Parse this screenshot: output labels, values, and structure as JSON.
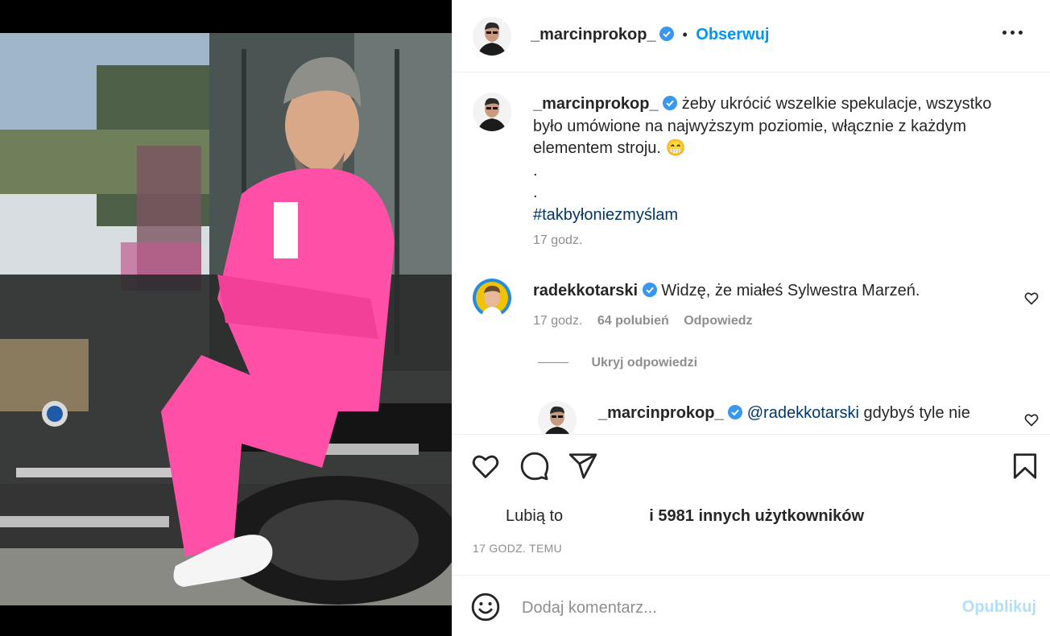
{
  "post": {
    "author": "_marcinprokop_",
    "follow_label": "Obserwuj",
    "separator": "•"
  },
  "caption": {
    "username": "_marcinprokop_",
    "text": "żeby ukrócić wszelkie spekulacje, wszystko było umówione na najwyższym poziomie, włącznie z każdym elementem stroju.",
    "emoji": "😁",
    "line_dot_1": ".",
    "line_dot_2": ".",
    "hashtag": "#takbyłoniezmyślam",
    "time": "17 godz."
  },
  "comment1": {
    "username": "radekkotarski",
    "text": "Widzę, że miałeś Sylwestra Marzeń.",
    "time": "17 godz.",
    "likes": "64 polubień",
    "reply_label": "Odpowiedz"
  },
  "hide_replies_label": "Ukryj odpowiedzi",
  "reply1": {
    "username": "_marcinprokop_",
    "mention": "@radekkotarski",
    "text": "gdybyś tyle nie"
  },
  "likes_row": {
    "prefix": "Lubią to",
    "suffix": "i 5981 innych użytkowników"
  },
  "time_ago": "17 GODZ. TEMU",
  "add_comment": {
    "placeholder": "Dodaj komentarz...",
    "publish_label": "Opublikuj"
  },
  "icons": {
    "verified": "verified-badge-icon",
    "like": "heart-icon",
    "comment": "comment-bubble-icon",
    "share": "paper-plane-icon",
    "save": "bookmark-icon",
    "more": "more-options-icon",
    "emoji": "emoji-smiley-icon"
  },
  "colors": {
    "accent": "#0095f6",
    "hashtag": "#00376b",
    "verified": "#3897f0",
    "muted": "#8e8e8e",
    "publish_disabled": "#b2dffc",
    "suit": "#ff4fa6"
  }
}
